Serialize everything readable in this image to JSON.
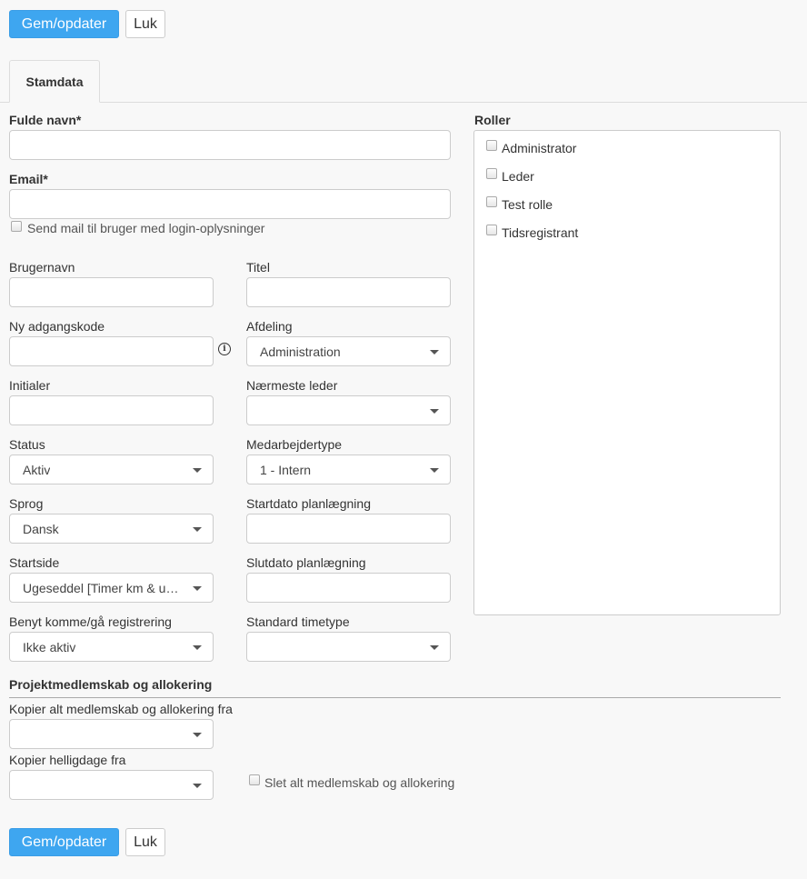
{
  "toolbar": {
    "save_label": "Gem/opdater",
    "close_label": "Luk"
  },
  "tabs": [
    {
      "label": "Stamdata"
    }
  ],
  "form": {
    "full_name": {
      "label": "Fulde navn*",
      "value": ""
    },
    "email": {
      "label": "Email*",
      "value": ""
    },
    "send_mail": {
      "label": "Send mail til bruger med login-oplysninger",
      "checked": false
    },
    "username": {
      "label": "Brugernavn",
      "value": ""
    },
    "title": {
      "label": "Titel",
      "value": ""
    },
    "password": {
      "label": "Ny adgangskode",
      "value": ""
    },
    "department": {
      "label": "Afdeling",
      "selected": "Administration"
    },
    "initials": {
      "label": "Initialer",
      "value": ""
    },
    "manager": {
      "label": "Nærmeste leder",
      "selected": ""
    },
    "status": {
      "label": "Status",
      "selected": "Aktiv"
    },
    "employee_type": {
      "label": "Medarbejdertype",
      "selected": "1 - Intern"
    },
    "language": {
      "label": "Sprog",
      "selected": "Dansk"
    },
    "start_date": {
      "label": "Startdato planlægning",
      "value": ""
    },
    "start_page": {
      "label": "Startside",
      "selected": "Ugeseddel [Timer km & udlæg]"
    },
    "end_date": {
      "label": "Slutdato planlægning",
      "value": ""
    },
    "checkin": {
      "label": "Benyt komme/gå registrering",
      "selected": "Ikke aktiv"
    },
    "default_timetype": {
      "label": "Standard timetype",
      "selected": ""
    }
  },
  "roles": {
    "label": "Roller",
    "items": [
      {
        "label": "Administrator",
        "checked": false
      },
      {
        "label": "Leder",
        "checked": false
      },
      {
        "label": "Test rolle",
        "checked": false
      },
      {
        "label": "Tidsregistrant",
        "checked": false
      }
    ]
  },
  "project": {
    "title": "Projektmedlemskab og allokering",
    "copy_membership": {
      "label": "Kopier alt medlemskab og allokering fra",
      "selected": ""
    },
    "copy_holidays": {
      "label": "Kopier helligdage fra",
      "selected": ""
    },
    "delete_membership": {
      "label": "Slet alt medlemskab og allokering",
      "checked": false
    }
  }
}
